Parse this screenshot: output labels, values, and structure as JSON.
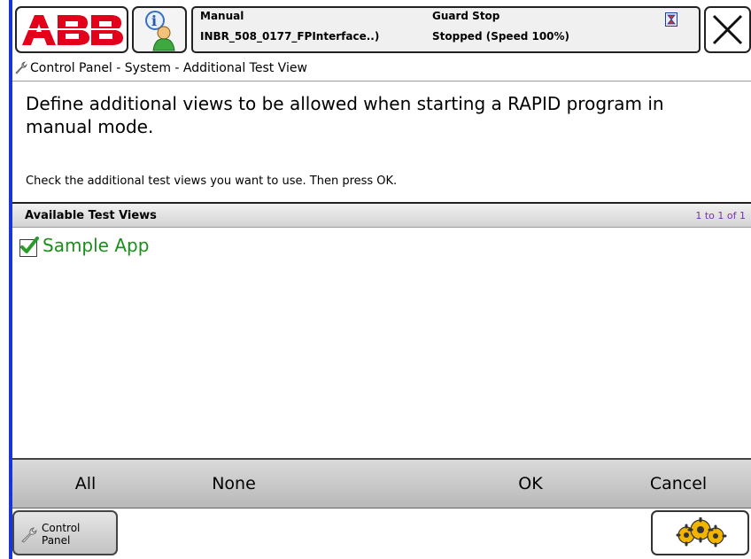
{
  "header": {
    "logo": "ABB",
    "mode": "Manual",
    "controller": "INBR_508_0177_FPInterface..)",
    "state": "Guard Stop",
    "program_state": "Stopped (Speed 100%)",
    "icons": {
      "info": "info-user-icon",
      "status": "hourglass-icon",
      "close": "close-x-icon"
    }
  },
  "breadcrumb": {
    "text": "Control Panel - System - Additional Test View",
    "icon": "control-panel-wrench-icon"
  },
  "intro_text": "Define additional views to be allowed when starting a RAPID program in manual mode.",
  "instruction_text": "Check the additional test views you want to use. Then press OK.",
  "list": {
    "header": "Available Test Views",
    "count": "1 to 1 of 1",
    "items": [
      {
        "label": "Sample App",
        "checked": true
      }
    ]
  },
  "commands": {
    "all": "All",
    "none": "None",
    "ok": "OK",
    "cancel": "Cancel"
  },
  "taskbar": {
    "control_panel_line1": "Control",
    "control_panel_line2": "Panel",
    "quickset_icon": "gears-icon"
  },
  "colors": {
    "accent": "#1a35d6",
    "abb_red": "#e2001a",
    "item_green": "#1b8e1b",
    "count_purple": "#7b2fb2"
  }
}
